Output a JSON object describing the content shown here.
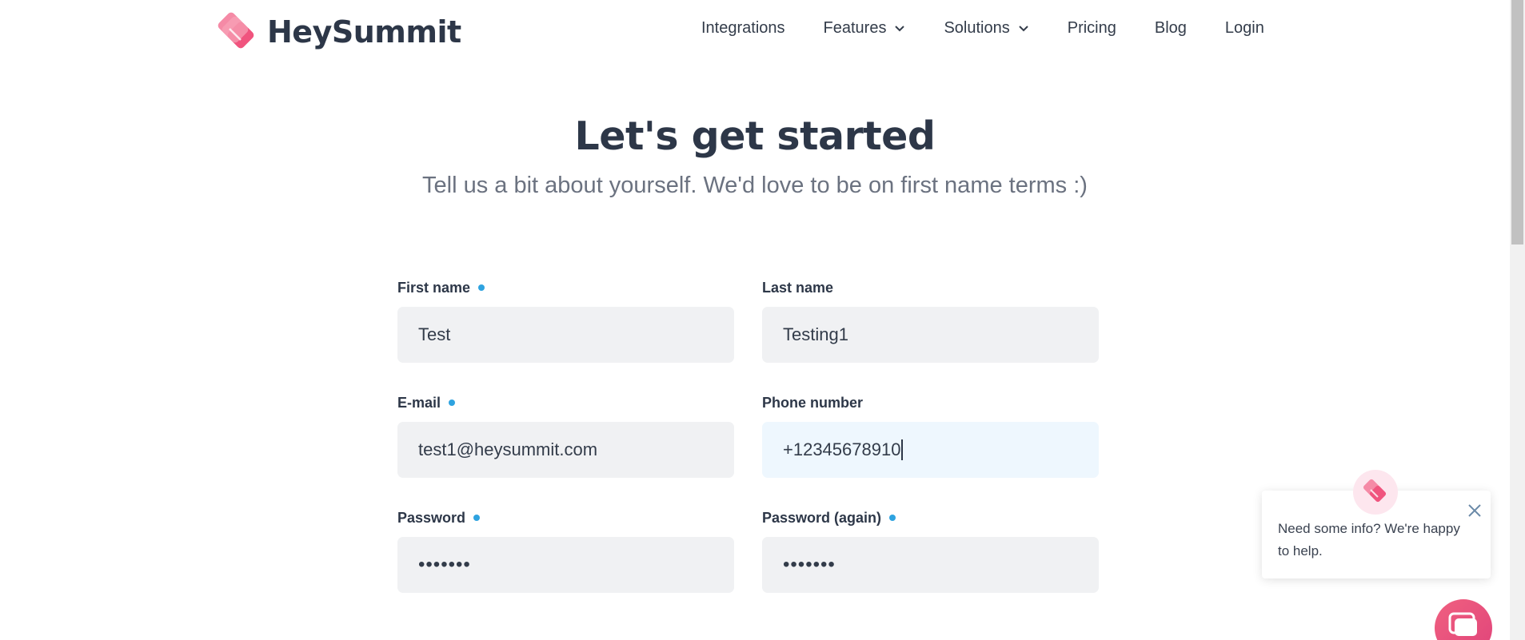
{
  "brand": {
    "name": "HeySummit",
    "primary_color": "#f0547e",
    "text_color": "#2d3748",
    "accent_dot_color": "#2ea3e0"
  },
  "nav": {
    "items": [
      {
        "label": "Integrations",
        "has_dropdown": false
      },
      {
        "label": "Features",
        "has_dropdown": true
      },
      {
        "label": "Solutions",
        "has_dropdown": true
      },
      {
        "label": "Pricing",
        "has_dropdown": false
      },
      {
        "label": "Blog",
        "has_dropdown": false
      },
      {
        "label": "Login",
        "has_dropdown": false
      }
    ]
  },
  "hero": {
    "title": "Let's get started",
    "subtitle": "Tell us a bit about yourself. We'd love to be on first name terms :)"
  },
  "form": {
    "first_name": {
      "label": "First name",
      "value": "Test",
      "required": true
    },
    "last_name": {
      "label": "Last name",
      "value": "Testing1",
      "required": false
    },
    "email": {
      "label": "E-mail",
      "value": "test1@heysummit.com",
      "required": true
    },
    "phone": {
      "label": "Phone number",
      "value": "+12345678910",
      "required": false,
      "focused": true
    },
    "password": {
      "label": "Password",
      "value": "•••••••",
      "required": true
    },
    "password_again": {
      "label": "Password (again)",
      "value": "•••••••",
      "required": true
    }
  },
  "chat": {
    "message": "Need some info? We're happy to help."
  }
}
